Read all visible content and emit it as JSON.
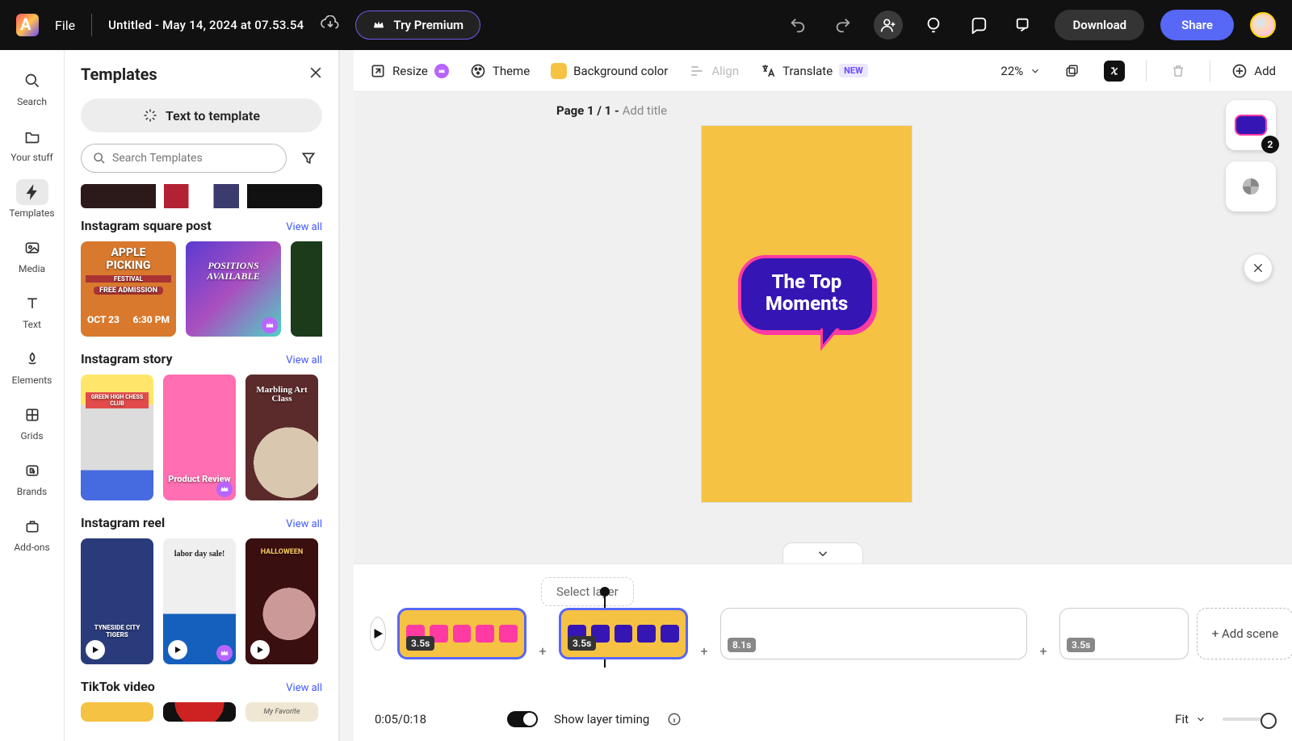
{
  "topbar": {
    "file": "File",
    "doc_title": "Untitled - May 14, 2024 at 07.53.54",
    "try_premium": "Try Premium",
    "download": "Download",
    "share": "Share"
  },
  "rail": [
    {
      "id": "search",
      "label": "Search"
    },
    {
      "id": "your-stuff",
      "label": "Your stuff"
    },
    {
      "id": "templates",
      "label": "Templates"
    },
    {
      "id": "media",
      "label": "Media"
    },
    {
      "id": "text",
      "label": "Text"
    },
    {
      "id": "elements",
      "label": "Elements"
    },
    {
      "id": "grids",
      "label": "Grids"
    },
    {
      "id": "brands",
      "label": "Brands"
    },
    {
      "id": "add-ons",
      "label": "Add-ons"
    }
  ],
  "panel": {
    "title": "Templates",
    "text_to_template": "Text to template",
    "search_placeholder": "Search Templates",
    "sections": [
      {
        "title": "Instagram square post",
        "view_all": "View all"
      },
      {
        "title": "Instagram story",
        "view_all": "View all"
      },
      {
        "title": "Instagram reel",
        "view_all": "View all"
      },
      {
        "title": "TikTok video",
        "view_all": "View all"
      }
    ],
    "sq_cards": {
      "apple1": "APPLE",
      "apple2": "PICKING",
      "apple3": "FESTIVAL",
      "apple4": "FREE ADMISSION",
      "apple5": "OCT 23",
      "apple6": "6:30 PM",
      "positions": "POSITIONS AVAILABLE"
    },
    "story_cards": {
      "chess": "GREEN HIGH CHESS CLUB",
      "review": "Product Review",
      "marble": "Marbling Art Class"
    },
    "reel_cards": {
      "tigers": "TYNESIDE CITY TIGERS",
      "labor": "labor day sale!",
      "hallo": "HALLOWEEN"
    },
    "tiktok": {
      "fav": "My Favorite"
    }
  },
  "toolbar": {
    "resize": "Resize",
    "theme": "Theme",
    "bg": "Background color",
    "align": "Align",
    "translate": "Translate",
    "new": "NEW",
    "zoom": "22%",
    "add": "Add"
  },
  "canvas": {
    "page_label": "Page 1 / 1 - ",
    "add_title": "Add title",
    "bubble_text1": "The Top",
    "bubble_text2": "Moments",
    "layer_count": "2"
  },
  "timeline": {
    "select_layer": "Select layer",
    "durations": {
      "c1": "3.5s",
      "c2": "3.5s",
      "c3": "8.1s",
      "c4": "3.5s"
    },
    "add_scene": "+ Add scene",
    "time": "0:05/0:18",
    "layer_timing": "Show layer timing",
    "fit": "Fit"
  }
}
